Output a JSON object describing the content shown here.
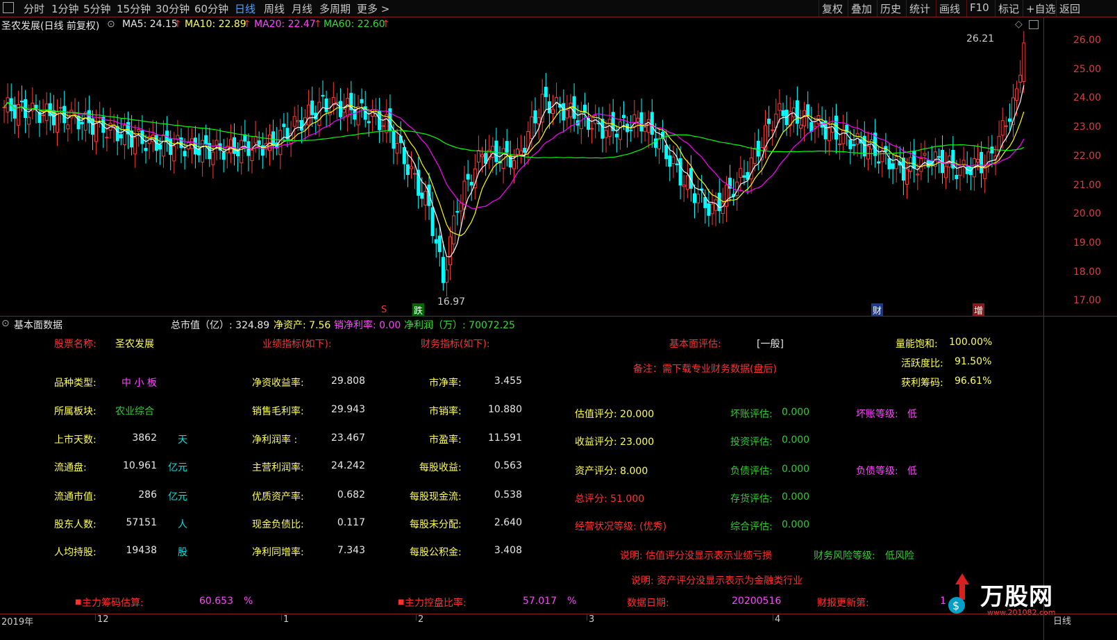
{
  "toolbar": {
    "tabs": [
      "分时",
      "1分钟",
      "5分钟",
      "15分钟",
      "30分钟",
      "60分钟",
      "日线",
      "周线",
      "月线",
      "多周期",
      "更多 >"
    ],
    "active_tab": "日线",
    "right_buttons": [
      "复权",
      "叠加",
      "历史",
      "统计",
      "画线",
      "F10",
      "标记",
      "+自选",
      "返回"
    ]
  },
  "chart_header": {
    "stock": "圣农发展(日线 前复权)",
    "ma5": "MA5: 24.15",
    "ma10": "MA10: 22.89",
    "ma20": "MA20: 22.47",
    "ma60": "MA60: 22.60"
  },
  "price_axis": [
    "26.00",
    "25.00",
    "24.00",
    "23.00",
    "22.00",
    "21.00",
    "20.00",
    "19.00",
    "18.00",
    "17.00"
  ],
  "annotations": {
    "high": "26.21",
    "low": "16.97",
    "mark_s": "S",
    "mark_die": "跌",
    "mark_cai": "财",
    "mark_zeng": "增"
  },
  "colors": {
    "up": "#ff3a3a",
    "down": "#00ffff",
    "ma5": "#ffffff",
    "ma10": "#ffff00",
    "ma20": "#ff00ff",
    "ma60": "#00ff00"
  },
  "fund_header": {
    "title": "基本面数据",
    "total_mv": "总市值（亿）: 324.89",
    "net_assets": "净资产: 7.56",
    "sales_profit": "销净利率: 0.00",
    "net_profit": "净利润（万）: 70072.25"
  },
  "left_block": {
    "name_label": "股票名称:",
    "name_value": "圣农发展",
    "type_label": "品种类型:",
    "type_value": "中 小 板",
    "sector_label": "所属板块:",
    "sector_value": "农业综合",
    "days_label": "上市天数:",
    "days_value": "3862",
    "days_unit": "天",
    "float_label": "流通盘:",
    "float_value": "10.961",
    "float_unit": "亿元",
    "fmv_label": "流通市值:",
    "fmv_value": "286",
    "fmv_unit": "亿元",
    "holders_label": "股东人数:",
    "holders_value": "57151",
    "holders_unit": "人",
    "avg_label": "人均持股:",
    "avg_value": "19438",
    "avg_unit": "股"
  },
  "perf": {
    "title": "业绩指标(如下):",
    "rows": [
      {
        "label": "净资收益率:",
        "value": "29.808"
      },
      {
        "label": "销售毛利率:",
        "value": "29.943"
      },
      {
        "label": "净利润率 :",
        "value": "23.467"
      },
      {
        "label": "主营利润率:",
        "value": "24.242"
      },
      {
        "label": "优质资产率:",
        "value": "0.682"
      },
      {
        "label": "现金负债比:",
        "value": "0.117"
      },
      {
        "label": "净利同增率:",
        "value": "7.343"
      }
    ]
  },
  "fin": {
    "title": "财务指标(如下):",
    "rows": [
      {
        "label": "市净率:",
        "value": "3.455"
      },
      {
        "label": "市销率:",
        "value": "10.880"
      },
      {
        "label": "市盈率:",
        "value": "11.591"
      },
      {
        "label": "每股收益:",
        "value": "0.563"
      },
      {
        "label": "每股现金流:",
        "value": "0.538"
      },
      {
        "label": "每股未分配:",
        "value": "2.640"
      },
      {
        "label": "每股公积金:",
        "value": "3.408"
      }
    ]
  },
  "eval": {
    "label": "基本面评估:",
    "value": "[一般]",
    "note": "备注：需下载专业财务数据(盘后)",
    "valuation": "估值评分: 20.000",
    "income": "收益评分: 23.000",
    "asset": "资产评分: 8.000",
    "total": "总评分: 51.000",
    "grade": "经营状况等级: (优秀)",
    "bad_debt": "坏账评估:",
    "bad_debt_v": "0.000",
    "invest": "投资评估:",
    "invest_v": "0.000",
    "debt": "负债评估:",
    "debt_v": "0.000",
    "stock": "存货评估:",
    "stock_v": "0.000",
    "overall": "综合评估:",
    "overall_v": "0.000",
    "bad_level": "坏账等级:",
    "bad_level_v": "低",
    "debt_level": "负债等级:",
    "debt_level_v": "低",
    "explain1": "说明: 估值评分没显示表示业绩亏损",
    "explain2": "说明: 资产评分没显示表示为金融类行业",
    "risk_label": "财务风险等级:",
    "risk_value": "低风险"
  },
  "right_block": {
    "vol_label": "量能饱和:",
    "vol_value": "100.00%",
    "act_label": "活跃度比:",
    "act_value": "91.50%",
    "profit_label": "获利筹码:",
    "profit_value": "96.61%"
  },
  "bottom": {
    "main_chip_label": "主力筹码估算:",
    "main_chip_value": "60.653",
    "main_chip_unit": "%",
    "control_label": "主力控盘比率:",
    "control_value": "57.017",
    "control_unit": "%",
    "date_label": "数据日期:",
    "date_value": "20200516",
    "update_label": "财报更新第:",
    "update_value": "1"
  },
  "timeline": [
    "2019年",
    "12",
    "1",
    "2",
    "3",
    "4"
  ],
  "period_label": "日线",
  "logo": {
    "text": "万股网",
    "url": "www.201082.com"
  }
}
